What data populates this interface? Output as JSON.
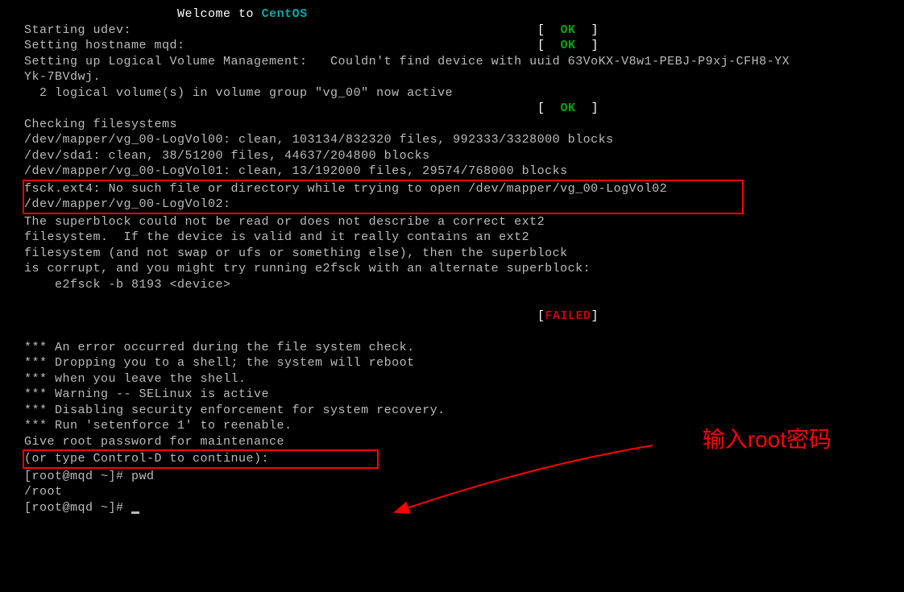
{
  "welcome_prefix": "Welcome to ",
  "welcome_os": "CentOS",
  "lines": {
    "udev": "Starting udev:",
    "hostname": "Setting hostname mqd:",
    "lvm": "Setting up Logical Volume Management:   Couldn't find device with uuid 63VoKX-V8w1-PEBJ-P9xj-CFH8-YX",
    "lvm2": "Yk-7BVdwj.",
    "volumes": "  2 logical volume(s) in volume group \"vg_00\" now active",
    "checking": "Checking filesystems",
    "fs1": "/dev/mapper/vg_00-LogVol00: clean, 103134/832320 files, 992333/3328000 blocks",
    "fs2": "/dev/sda1: clean, 38/51200 files, 44637/204800 blocks",
    "fs3": "/dev/mapper/vg_00-LogVol01: clean, 13/192000 files, 29574/768000 blocks",
    "fsck1": "fsck.ext4: No such file or directory while trying to open /dev/mapper/vg_00-LogVol02",
    "fsck2": "/dev/mapper/vg_00-LogVol02: ",
    "sb1": "The superblock could not be read or does not describe a correct ext2",
    "sb2": "filesystem.  If the device is valid and it really contains an ext2",
    "sb3": "filesystem (and not swap or ufs or something else), then the superblock",
    "sb4": "is corrupt, and you might try running e2fsck with an alternate superblock:",
    "sb5": "    e2fsck -b 8193 <device>",
    "err1": "*** An error occurred during the file system check.",
    "err2": "*** Dropping you to a shell; the system will reboot",
    "err3": "*** when you leave the shell.",
    "err4": "*** Warning -- SELinux is active",
    "err5": "*** Disabling security enforcement for system recovery.",
    "err6": "*** Run 'setenforce 1' to reenable.",
    "give_root": "Give root password for maintenance",
    "ctrl_d": "(or type Control-D to continue): ",
    "prompt1": "[root@mqd ~]# pwd",
    "pwd_out": "/root",
    "prompt2": "[root@mqd ~]# "
  },
  "status": {
    "lbracket": "[  ",
    "rbracket": "  ]",
    "ok": "OK",
    "failed": "FAILED",
    "failed_l": "[",
    "failed_r": "]"
  },
  "annotation": "输入root密码"
}
